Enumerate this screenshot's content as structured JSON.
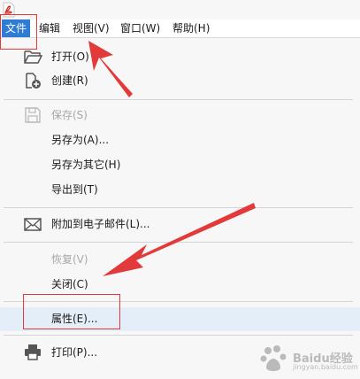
{
  "menubar": {
    "items": [
      {
        "label": "文件"
      },
      {
        "label": "编辑"
      },
      {
        "label": "视图(V)"
      },
      {
        "label": "窗口(W)"
      },
      {
        "label": "帮助(H)"
      }
    ]
  },
  "file_menu": {
    "items": [
      {
        "label": "打开(O)",
        "icon": "folder-open-icon",
        "enabled": true
      },
      {
        "label": "创建(R)",
        "icon": "create-document-icon",
        "enabled": true
      },
      {
        "label": "保存(S)",
        "icon": "save-icon",
        "enabled": false
      },
      {
        "label": "另存为(A)...",
        "enabled": true
      },
      {
        "label": "另存为其它(H)",
        "enabled": true
      },
      {
        "label": "导出到(T)",
        "enabled": true
      },
      {
        "label": "附加到电子邮件(L)...",
        "icon": "email-icon",
        "enabled": true
      },
      {
        "label": "恢复(V)",
        "enabled": false
      },
      {
        "label": "关闭(C)",
        "enabled": true
      },
      {
        "label": "属性(E)...",
        "enabled": true,
        "hovered": true
      },
      {
        "label": "打印(P)...",
        "icon": "printer-icon",
        "enabled": true
      }
    ]
  },
  "watermark": {
    "brand": "Baidu经验",
    "sub": "jingyan.baidu.com"
  },
  "annotation_color": "#e23a3a",
  "highlight_color": "#2e7cd6"
}
